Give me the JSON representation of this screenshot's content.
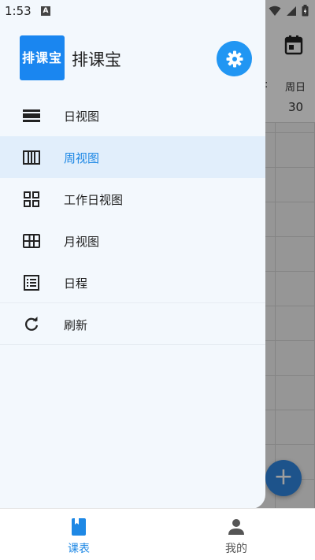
{
  "status_bar": {
    "time": "1:53",
    "badge": "A"
  },
  "app_name": "排课宝",
  "logo_text": "排课宝",
  "menu": [
    {
      "label": "日视图",
      "icon": "day-view-icon",
      "active": false
    },
    {
      "label": "周视图",
      "icon": "week-view-icon",
      "active": true
    },
    {
      "label": "工作日视图",
      "icon": "workday-view-icon",
      "active": false
    },
    {
      "label": "月视图",
      "icon": "month-view-icon",
      "active": false
    },
    {
      "label": "日程",
      "icon": "schedule-list-icon",
      "active": false
    },
    {
      "label": "刷新",
      "icon": "refresh-icon",
      "active": false
    }
  ],
  "background": {
    "weekday_label": "周日",
    "weekday_date": "30",
    "edge_char": ":"
  },
  "fab_label": "+",
  "bottom_nav": [
    {
      "label": "课表",
      "icon": "book-icon",
      "selected": true
    },
    {
      "label": "我的",
      "icon": "person-icon",
      "selected": false
    }
  ],
  "colors": {
    "accent": "#1e88e5",
    "drawer_bg": "#f3f8fd",
    "active_row": "#e1eefb"
  }
}
